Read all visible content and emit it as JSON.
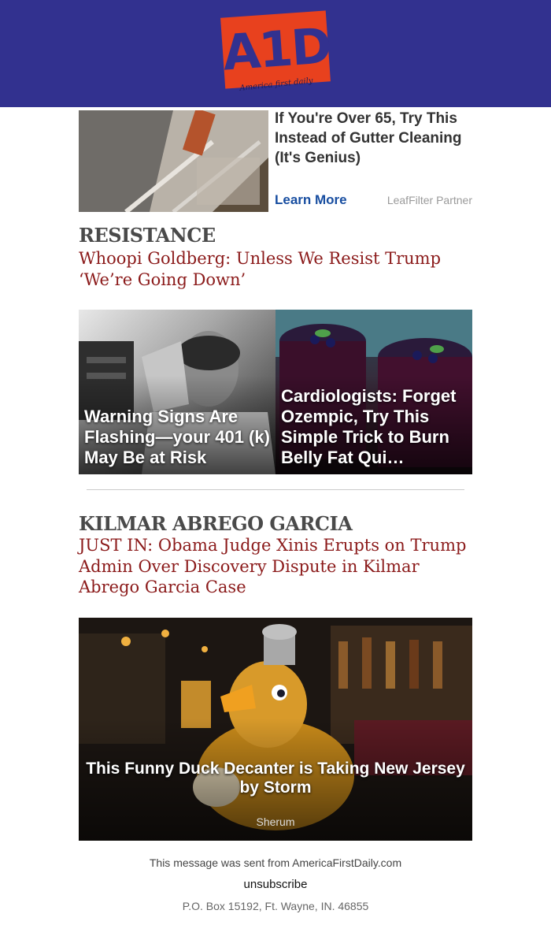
{
  "header": {
    "logo_text": "A1D",
    "logo_tagline": "America first daily",
    "background_color": "#32318f",
    "logo_color": "#e8411e"
  },
  "ad_top": {
    "title": "If You're Over 65, Try This Instead of Gutter Cleaning (It's Genius)",
    "cta": "Learn More",
    "sponsor": "LeafFilter Partner",
    "image": "gutter-photo"
  },
  "story1": {
    "section": "RESISTANCE",
    "headline": "Whoopi Goldberg: Unless We Resist Trump ‘We’re Going Down’"
  },
  "tiles": [
    {
      "caption": "Warning Signs Are Flashing—your 401 (k) May Be at Risk",
      "image": "stressed-man-photo"
    },
    {
      "caption": "Cardiologists: Forget Ozempic, Try This Simple Trick to Burn Belly Fat  Qui…",
      "image": "berry-drinks-photo"
    }
  ],
  "story2": {
    "section": "KILMAR ABREGO GARCIA",
    "headline": "JUST IN: Obama Judge Xinis Erupts on Trump Admin Over Discovery Dispute in Kilmar Abrego Garcia Case"
  },
  "big_tile": {
    "caption": "This Funny Duck Decanter is Taking New Jersey by Storm",
    "source": "Sherum",
    "image": "duck-decanter-photo"
  },
  "footer": {
    "sent_from": "This message was sent from AmericaFirstDaily.com",
    "unsubscribe": "unsubscribe",
    "address": "P.O. Box 15192, Ft. Wayne, IN. 46855"
  },
  "colors": {
    "headline_red": "#8b1a1a",
    "section_gray": "#4a4a4a",
    "link_blue": "#174da0"
  }
}
